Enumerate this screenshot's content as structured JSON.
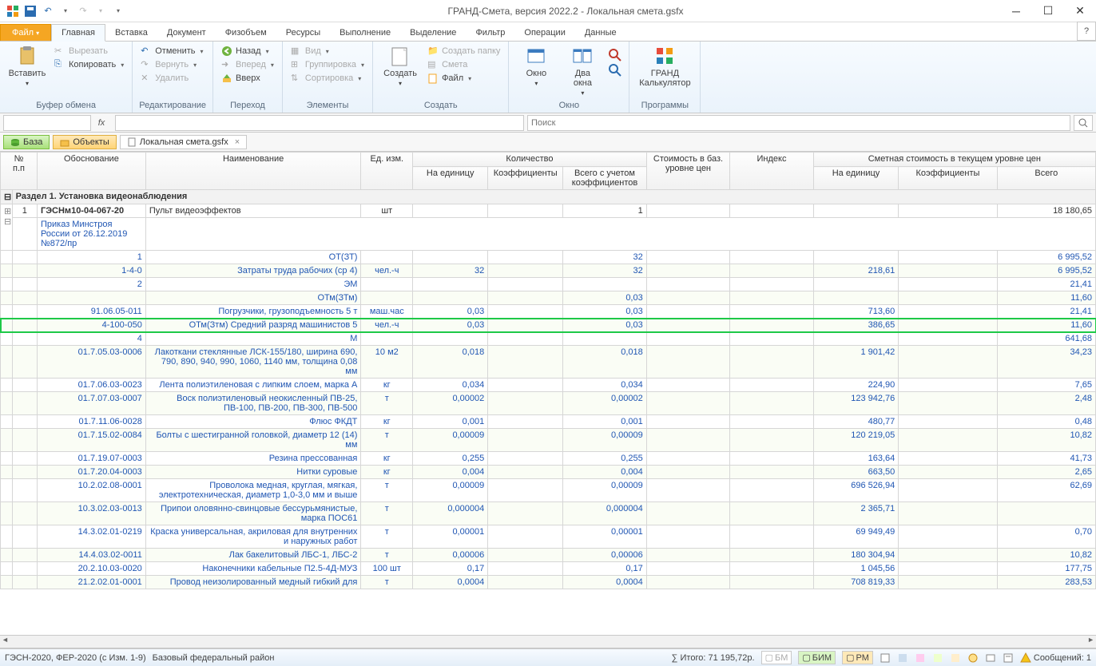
{
  "title": "ГРАНД-Смета, версия 2022.2 - Локальная смета.gsfx",
  "tabs": {
    "file": "Файл",
    "list": [
      "Главная",
      "Вставка",
      "Документ",
      "Физобъем",
      "Ресурсы",
      "Выполнение",
      "Выделение",
      "Фильтр",
      "Операции",
      "Данные"
    ],
    "active": 0
  },
  "ribbon": {
    "clipboard": {
      "label": "Буфер обмена",
      "paste": "Вставить",
      "cut": "Вырезать",
      "copy": "Копировать"
    },
    "edit": {
      "label": "Редактирование",
      "undo": "Отменить",
      "redo": "Вернуть",
      "delete": "Удалить"
    },
    "nav": {
      "label": "Переход",
      "back": "Назад",
      "forward": "Вперед",
      "up": "Вверх"
    },
    "elements": {
      "label": "Элементы",
      "view": "Вид",
      "group": "Группировка",
      "sort": "Сортировка"
    },
    "create": {
      "label": "Создать",
      "create": "Создать",
      "folder": "Создать папку",
      "smeta": "Смета",
      "file": "Файл"
    },
    "window": {
      "label": "Окно",
      "window": "Окно",
      "two": "Два\nокна"
    },
    "programs": {
      "label": "Программы",
      "calc": "ГРАНД\nКалькулятор"
    }
  },
  "fx": {
    "search_ph": "Поиск"
  },
  "nav": {
    "base": "База",
    "objects": "Объекты",
    "doc": "Локальная смета.gsfx"
  },
  "headers": {
    "num": "№\nп.п",
    "basis": "Обоснование",
    "name": "Наименование",
    "unit": "Ед. изм.",
    "qty": "Количество",
    "qty1": "На единицу",
    "qty2": "Коэффициенты",
    "qty3": "Всего с учетом\nкоэффициентов",
    "baseprice": "Стоимость в баз.\nуровне цен",
    "index": "Индекс",
    "cur": "Сметная стоимость в текущем уровне цен",
    "cur1": "На единицу",
    "cur2": "Коэффициенты",
    "cur3": "Всего"
  },
  "section": "Раздел 1. Установка видеонаблюдения",
  "row1": {
    "num": "1",
    "basis": "ГЭСНм10-04-067-20",
    "basis2": "Приказ Минстроя России от 26.12.2019 №872/пр",
    "name": "Пульт видеоэффектов",
    "unit": "шт",
    "qty3": "1",
    "total": "18 180,65"
  },
  "rows": [
    {
      "b": "1",
      "n": "ОТ(ЗТ)",
      "u": "",
      "q1": "",
      "q3": "32",
      "p1": "",
      "t": "6 995,52"
    },
    {
      "b": "1-4-0",
      "n": "Затраты труда рабочих (ср 4)",
      "u": "чел.-ч",
      "q1": "32",
      "q3": "32",
      "p1": "218,61",
      "t": "6 995,52"
    },
    {
      "b": "2",
      "n": "ЭМ",
      "u": "",
      "q1": "",
      "q3": "",
      "p1": "",
      "t": "21,41"
    },
    {
      "b": "",
      "n": "ОТм(ЗТм)",
      "u": "",
      "q1": "",
      "q3": "0,03",
      "p1": "",
      "t": "11,60"
    },
    {
      "b": "91.06.05-011",
      "n": "Погрузчики, грузоподъемность 5 т",
      "u": "маш.час",
      "q1": "0,03",
      "q3": "0,03",
      "p1": "713,60",
      "t": "21,41"
    },
    {
      "b": "4-100-050",
      "n": "ОТм(Зтм) Средний разряд машинистов 5",
      "u": "чел.-ч",
      "q1": "0,03",
      "q3": "0,03",
      "p1": "386,65",
      "t": "11,60",
      "hl": true
    },
    {
      "b": "4",
      "n": "М",
      "u": "",
      "q1": "",
      "q3": "",
      "p1": "",
      "t": "641,68"
    },
    {
      "b": "01.7.05.03-0006",
      "n": "Лакоткани стеклянные ЛСК-155/180, ширина 690, 790, 890, 940, 990, 1060, 1140 мм, толщина 0,08 мм",
      "u": "10 м2",
      "q1": "0,018",
      "q3": "0,018",
      "p1": "1 901,42",
      "t": "34,23"
    },
    {
      "b": "01.7.06.03-0023",
      "n": "Лента полиэтиленовая с липким слоем, марка А",
      "u": "кг",
      "q1": "0,034",
      "q3": "0,034",
      "p1": "224,90",
      "t": "7,65"
    },
    {
      "b": "01.7.07.03-0007",
      "n": "Воск полиэтиленовый неокисленный ПВ-25, ПВ-100, ПВ-200, ПВ-300, ПВ-500",
      "u": "т",
      "q1": "0,00002",
      "q3": "0,00002",
      "p1": "123 942,76",
      "t": "2,48"
    },
    {
      "b": "01.7.11.06-0028",
      "n": "Флюс ФКДТ",
      "u": "кг",
      "q1": "0,001",
      "q3": "0,001",
      "p1": "480,77",
      "t": "0,48"
    },
    {
      "b": "01.7.15.02-0084",
      "n": "Болты с шестигранной головкой, диаметр 12 (14) мм",
      "u": "т",
      "q1": "0,00009",
      "q3": "0,00009",
      "p1": "120 219,05",
      "t": "10,82"
    },
    {
      "b": "01.7.19.07-0003",
      "n": "Резина прессованная",
      "u": "кг",
      "q1": "0,255",
      "q3": "0,255",
      "p1": "163,64",
      "t": "41,73"
    },
    {
      "b": "01.7.20.04-0003",
      "n": "Нитки суровые",
      "u": "кг",
      "q1": "0,004",
      "q3": "0,004",
      "p1": "663,50",
      "t": "2,65"
    },
    {
      "b": "10.2.02.08-0001",
      "n": "Проволока медная, круглая, мягкая, электротехническая, диаметр 1,0-3,0 мм и выше",
      "u": "т",
      "q1": "0,00009",
      "q3": "0,00009",
      "p1": "696 526,94",
      "t": "62,69"
    },
    {
      "b": "10.3.02.03-0013",
      "n": "Припои оловянно-свинцовые бессурьмянистые, марка ПОС61",
      "u": "т",
      "q1": "0,000004",
      "q3": "0,000004",
      "p1": "2 365,71",
      "t": ""
    },
    {
      "b": "14.3.02.01-0219",
      "n": "Краска универсальная, акриловая для внутренних и наружных работ",
      "u": "т",
      "q1": "0,00001",
      "q3": "0,00001",
      "p1": "69 949,49",
      "t": "0,70"
    },
    {
      "b": "14.4.03.02-0011",
      "n": "Лак бакелитовый ЛБС-1, ЛБС-2",
      "u": "т",
      "q1": "0,00006",
      "q3": "0,00006",
      "p1": "180 304,94",
      "t": "10,82"
    },
    {
      "b": "20.2.10.03-0020",
      "n": "Наконечники кабельные П2.5-4Д-МУЗ",
      "u": "100 шт",
      "q1": "0,17",
      "q3": "0,17",
      "p1": "1 045,56",
      "t": "177,75"
    },
    {
      "b": "21.2.02.01-0001",
      "n": "Провод неизолированный медный гибкий для",
      "u": "т",
      "q1": "0,0004",
      "q3": "0,0004",
      "p1": "708 819,33",
      "t": "283,53"
    }
  ],
  "status": {
    "left1": "ГЭСН-2020, ФЕР-2020 (с Изм. 1-9)",
    "left2": "Базовый федеральный район",
    "total": "Итого: 71 195,72р.",
    "bm": "БМ",
    "bim": "БИМ",
    "rm": "РМ",
    "msg": "Сообщений: 1"
  }
}
